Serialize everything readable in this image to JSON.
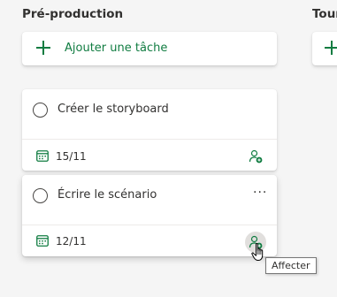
{
  "columns": [
    {
      "title": "Pré-production",
      "add_task_label": "Ajouter une tâche"
    },
    {
      "title": "Tour"
    }
  ],
  "tasks": [
    {
      "title": "Créer le storyboard",
      "due_date": "15/11"
    },
    {
      "title": "Écrire le scénario",
      "due_date": "12/11",
      "more_label": "···"
    }
  ],
  "tooltip": {
    "text": "Affecter"
  },
  "colors": {
    "accent": "#107c41",
    "board_bg": "#f5f5f5",
    "card_bg": "#ffffff"
  },
  "icons": [
    "plus-icon",
    "circle-check-icon",
    "calendar-icon",
    "assign-person-icon",
    "more-icon",
    "hand-cursor-icon"
  ]
}
